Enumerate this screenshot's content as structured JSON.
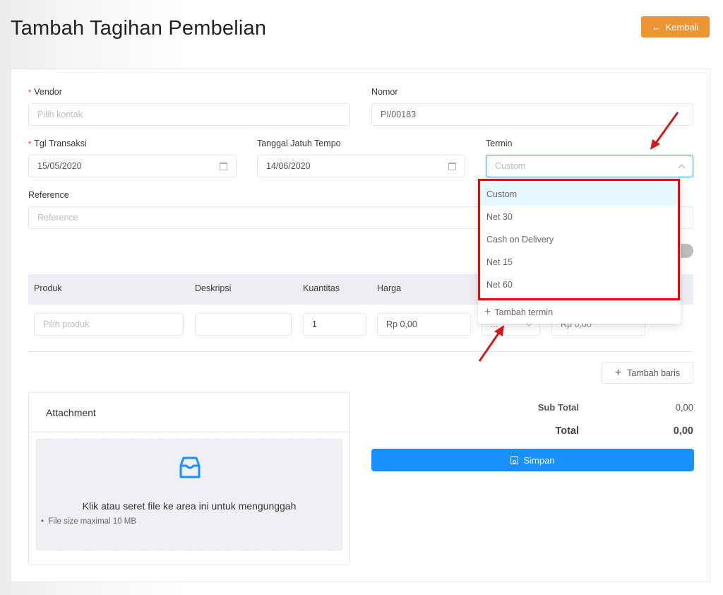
{
  "page": {
    "title": "Tambah Tagihan Pembelian",
    "back_button": "Kembali"
  },
  "form": {
    "vendor": {
      "label": "Vendor",
      "required": "*",
      "placeholder": "Pilih kontak",
      "value": ""
    },
    "nomor": {
      "label": "Nomor",
      "value": "PI/00183"
    },
    "tgl_transaksi": {
      "label": "Tgl Transaksi",
      "required": "*",
      "value": "15/05/2020"
    },
    "tanggal_jatuh_tempo": {
      "label": "Tanggal Jatuh Tempo",
      "value": "14/06/2020"
    },
    "termin": {
      "label": "Termin",
      "placeholder": "Custom",
      "open": true
    },
    "reference": {
      "label": "Reference",
      "placeholder": "Reference"
    }
  },
  "termin_dropdown": {
    "options": [
      "Custom",
      "Net 30",
      "Cash on Delivery",
      "Net 15",
      "Net 60"
    ],
    "selected": "Custom",
    "add_label": "Tambah termin"
  },
  "table": {
    "headers": [
      "Produk",
      "Deskripsi",
      "Kuantitas",
      "Harga"
    ],
    "row": {
      "produk_placeholder": "Pilih produk",
      "deskripsi": "",
      "kuantitas": "1",
      "harga": "Rp 0,00",
      "pajak": "...",
      "jumlah": "Rp 0,00"
    },
    "add_row_label": "Tambah baris"
  },
  "attachment": {
    "title": "Attachment",
    "dropzone_text": "Klik atau seret file ke area ini untuk mengunggah",
    "note": "File size maximal 10 MB"
  },
  "summary": {
    "subtotal_label": "Sub Total",
    "subtotal_value": "0,00",
    "total_label": "Total",
    "total_value": "0,00"
  },
  "save_button": "Simpan",
  "colors": {
    "primary": "#1890ff",
    "back_button": "#ee9533",
    "highlight_annotation": "#ff0000",
    "required": "#f5222d"
  }
}
